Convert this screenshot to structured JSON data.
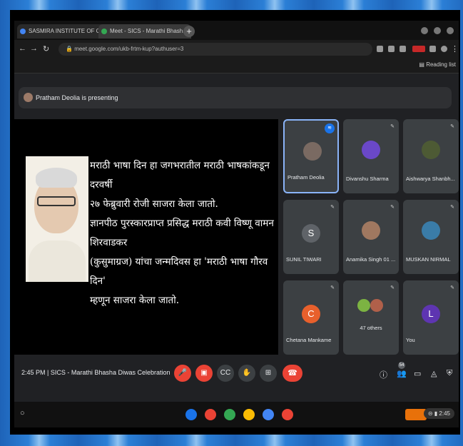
{
  "browser": {
    "tabs": [
      {
        "label": "SASMIRA INSTITUTE OF COMM...",
        "color": "#4285f4"
      },
      {
        "label": "Meet - SICS - Marathi Bhash...",
        "color": "#34a853"
      }
    ],
    "url": "meet.google.com/ukb-frtm-kup?authuser=3",
    "reading_list": "Reading list"
  },
  "meet": {
    "presenting_banner": "Pratham Deolia is presenting",
    "slide_text": [
      "मराठी भाषा दिन हा जगभरातील मराठी भाषकांकडून दरवर्षी",
      "२७ फेब्रुवारी रोजी साजरा केला जातो.",
      "ज्ञानपीठ पुरस्कारप्राप्त प्रसिद्ध मराठी कवी विष्णू वामन शिरवाडकर",
      "(कुसुमाग्रज) यांचा जन्मदिवस हा 'मराठी भाषा गौरव दिन'",
      "म्हणून साजरा केला जातो."
    ],
    "participants": [
      {
        "name": "Pratham Deolia",
        "kind": "photo",
        "color": "#7a6a62",
        "speaking": true
      },
      {
        "name": "Divanshu Sharma",
        "kind": "photo",
        "color": "#6a48c8"
      },
      {
        "name": "Aishwarya Shanbh...",
        "kind": "photo",
        "color": "#4d5a34"
      },
      {
        "name": "SUNIL TIWARI",
        "kind": "letter",
        "letter": "S",
        "color": "#5f6368"
      },
      {
        "name": "Anamika Singh 01 ...",
        "kind": "photo",
        "color": "#a07860"
      },
      {
        "name": "MUSKAN NIRMAL",
        "kind": "photo",
        "color": "#3a7ca8"
      },
      {
        "name": "Chetana Mankame",
        "kind": "letter",
        "letter": "C",
        "color": "#e8602c"
      },
      {
        "name": "47 others",
        "kind": "others",
        "color": "#7cb342"
      },
      {
        "name": "You",
        "kind": "letter",
        "letter": "L",
        "color": "#5e35b1"
      }
    ],
    "time": "2:45 PM",
    "separator": "|",
    "meeting_title": "SICS - Marathi Bhasha Diwas Celebration",
    "people_count": "54"
  },
  "shelf": {
    "time": "2:45",
    "apps": [
      {
        "name": "files",
        "color": "#1a73e8"
      },
      {
        "name": "gmail",
        "color": "#ea4335"
      },
      {
        "name": "play-store",
        "color": "#34a853"
      },
      {
        "name": "chrome",
        "color": "#fbbc04"
      },
      {
        "name": "drive",
        "color": "#4285f4"
      },
      {
        "name": "other",
        "color": "#ea4335"
      }
    ]
  },
  "colors": {
    "end_call": "#ea4335",
    "accent": "#8ab4f8",
    "background": "#202124"
  }
}
